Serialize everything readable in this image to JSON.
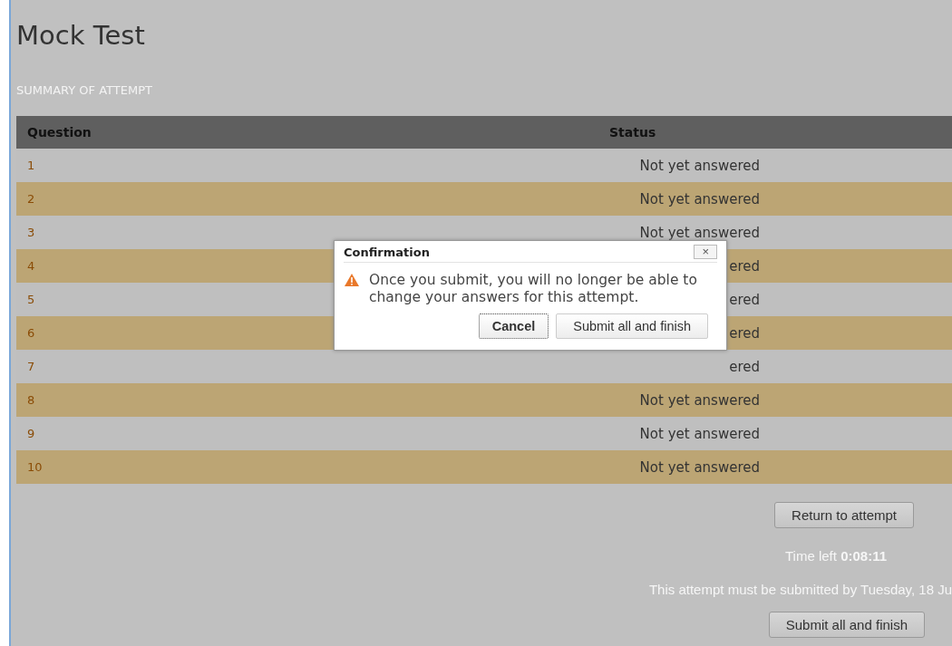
{
  "page": {
    "title": "Mock Test",
    "subtitle": "SUMMARY OF ATTEMPT"
  },
  "table": {
    "columns": [
      "Question",
      "Status"
    ],
    "rows": [
      {
        "question": "1",
        "status": "Not yet answered"
      },
      {
        "question": "2",
        "status": "Not yet answered"
      },
      {
        "question": "3",
        "status": "Not yet answered"
      },
      {
        "question": "4",
        "status": "ered"
      },
      {
        "question": "5",
        "status": "ered"
      },
      {
        "question": "6",
        "status": "ered"
      },
      {
        "question": "7",
        "status": "ered"
      },
      {
        "question": "8",
        "status": "Not yet answered"
      },
      {
        "question": "9",
        "status": "Not yet answered"
      },
      {
        "question": "10",
        "status": "Not yet answered"
      }
    ]
  },
  "return_button": "Return to attempt",
  "time_left": "Time left **0:08:11**",
  "deadline": "This attempt must be submitted by Tuesday, 18 Ju",
  "submit_button": "Submit all and finish",
  "dialog": {
    "title": "Confirmation",
    "close": "×",
    "message": "Once you submit, you will no longer be able to change your answers for this attempt.",
    "buttons": [
      {
        "label": "Cancel",
        "selected": true
      },
      {
        "label": "Submit all and finish",
        "selected": false
      }
    ]
  }
}
